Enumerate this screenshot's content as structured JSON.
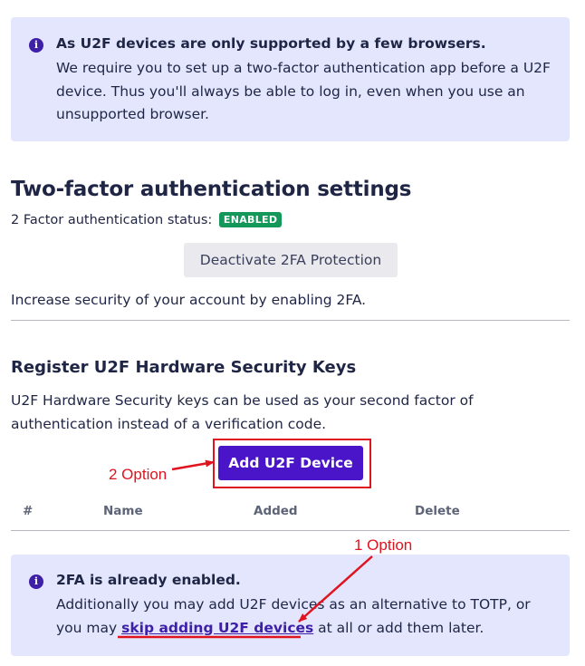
{
  "info_top": {
    "icon": "info-icon",
    "title": "As U2F devices are only supported by a few browsers.",
    "body": "We require you to set up a two-factor authentication app before a U2F device. Thus you'll always be able to log in, even when you use an unsupported browser."
  },
  "two_factor": {
    "title": "Two-factor authentication settings",
    "status_label": "2 Factor authentication status:",
    "status_badge": "ENABLED",
    "deactivate_label": "Deactivate 2FA Protection",
    "increase_text": "Increase security of your account by enabling 2FA."
  },
  "u2f": {
    "title": "Register U2F Hardware Security Keys",
    "description": "U2F Hardware Security keys can be used as your second factor of authentication instead of a verification code.",
    "add_label": "Add U2F Device",
    "table_headers": [
      "#",
      "Name",
      "Added",
      "Delete"
    ]
  },
  "info_bottom": {
    "icon": "info-icon",
    "title": "2FA is already enabled.",
    "body_before": "Additionally you may add U2F devices as an alternative to TOTP, or you may ",
    "link": "skip adding U2F devices",
    "body_after": " at all or add them later."
  },
  "annotations": {
    "option_2": "2 Option",
    "option_1": "1 Option",
    "color": "#e0141f"
  },
  "colors": {
    "accent": "#4a15c8",
    "info_bg": "#e3e6fd",
    "badge_green": "#13985a"
  }
}
